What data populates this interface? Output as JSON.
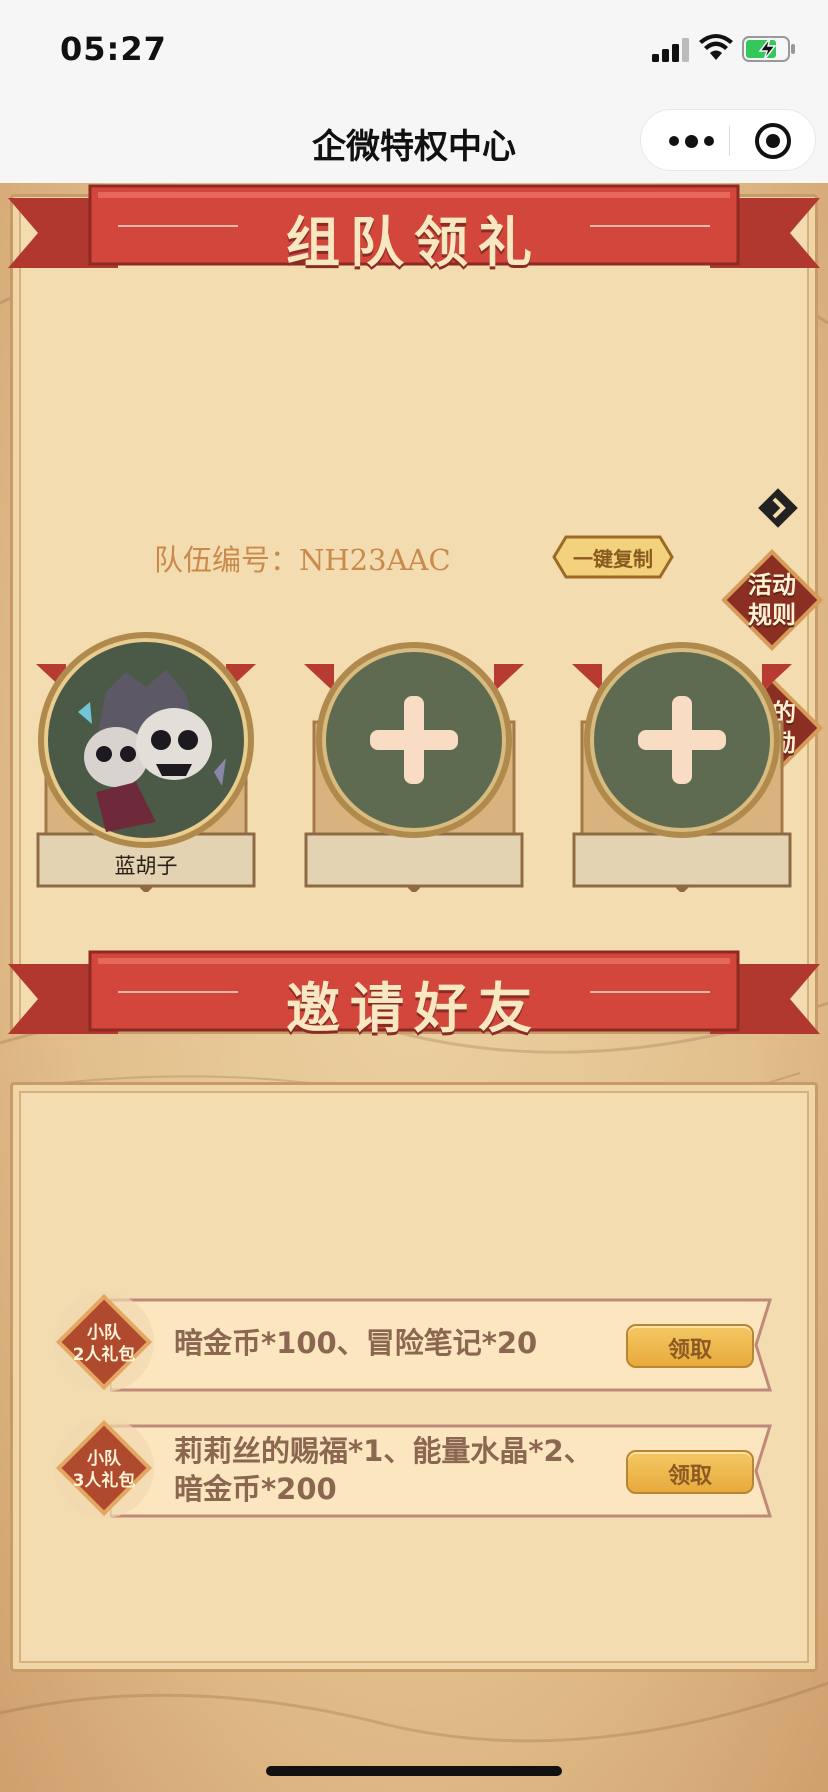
{
  "status_bar": {
    "time": "05:27"
  },
  "nav": {
    "title": "企微特权中心"
  },
  "team_section": {
    "ribbon_title": "组队领礼",
    "team_number": "队伍编号：NH23AAC",
    "copy_button": "一键复制",
    "members": [
      {
        "name": "蓝胡子",
        "filled": true
      },
      {
        "name": "",
        "filled": false
      },
      {
        "name": "",
        "filled": false
      }
    ]
  },
  "side_menu": [
    {
      "label_line1": "活动",
      "label_line2": "规则"
    },
    {
      "label_line1": "我的",
      "label_line2": "奖励"
    }
  ],
  "invite_section": {
    "ribbon_title": "邀请好友",
    "gifts": [
      {
        "badge_line1": "小队",
        "badge_line2": "2人礼包",
        "text_line1": "暗金币*100、冒险笔记*20",
        "text_line2": "",
        "button": "领取"
      },
      {
        "badge_line1": "小队",
        "badge_line2": "3人礼包",
        "text_line1": "莉莉丝的赐福*1、能量水晶*2、",
        "text_line2": "暗金币*200",
        "button": "领取"
      }
    ]
  },
  "colors": {
    "ribbon": "#c9433a",
    "panel": "#f3dcaf",
    "slot_circle": "#5f6b51",
    "badge": "#b04a2e",
    "claim": "#f1be55"
  }
}
